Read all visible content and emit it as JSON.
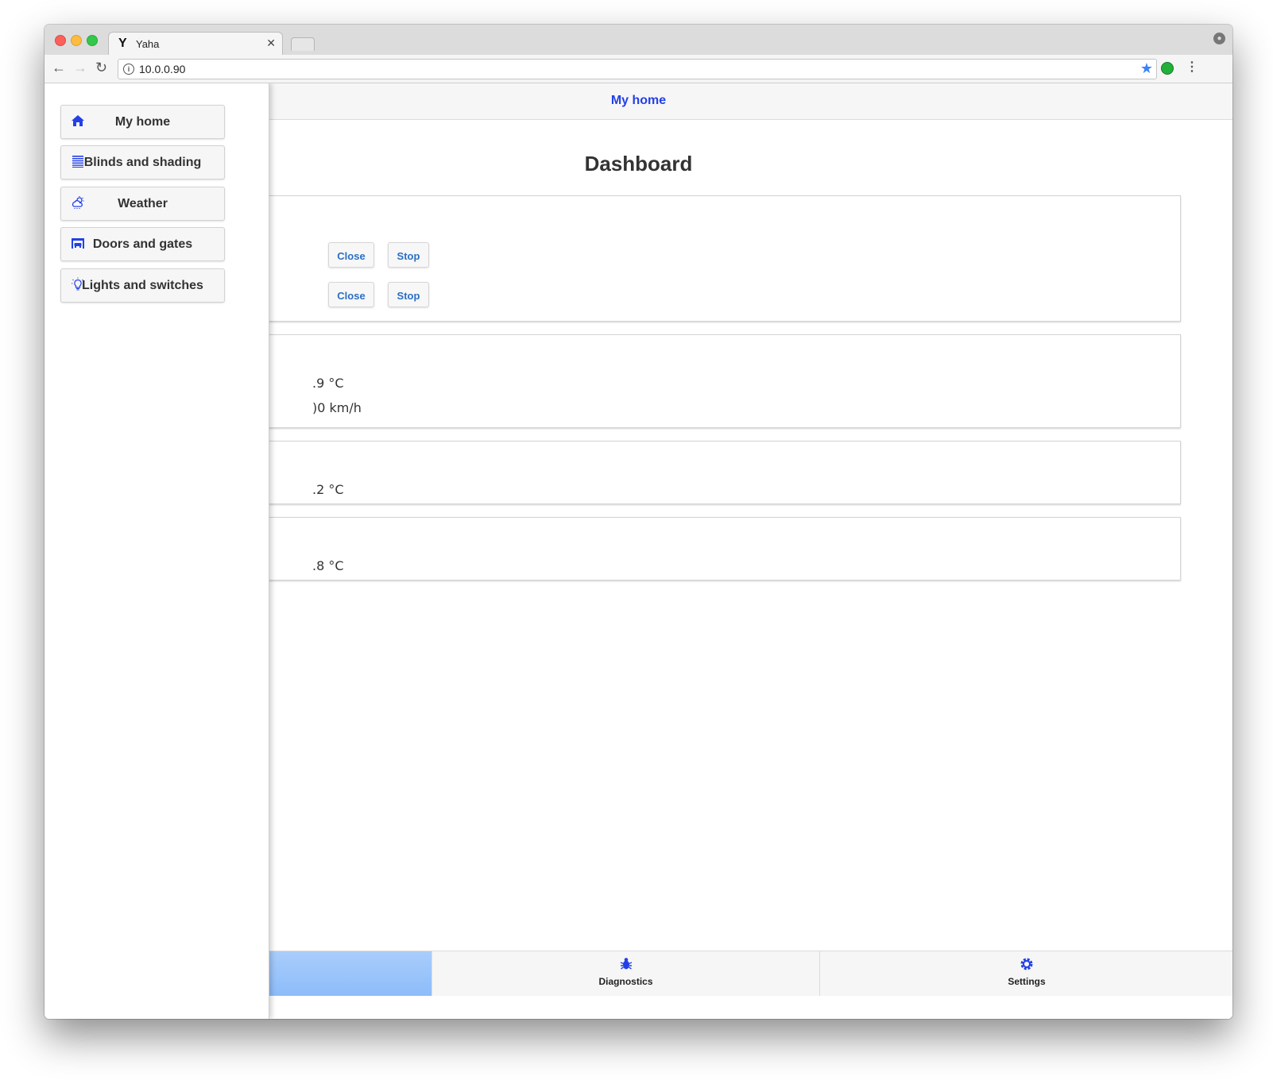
{
  "browser": {
    "tab_title": "Yaha",
    "tab_favicon": "Y",
    "url": "10.0.0.90"
  },
  "header": {
    "title": "My home"
  },
  "main": {
    "page_title": "Dashboard",
    "blinds": {
      "rows": [
        {
          "close_label": "Close",
          "stop_label": "Stop"
        },
        {
          "close_label": "Close",
          "stop_label": "Stop"
        }
      ]
    },
    "weather_card": {
      "temperature": ".9 °C",
      "wind": ")0 km/h"
    },
    "card3": {
      "temperature": ".2 °C"
    },
    "card4": {
      "temperature": ".8 °C"
    }
  },
  "sidebar": {
    "items": [
      {
        "label": "My home",
        "icon": "home-icon"
      },
      {
        "label": "Blinds and shading",
        "icon": "blinds-icon"
      },
      {
        "label": "Weather",
        "icon": "weather-icon"
      },
      {
        "label": "Doors and gates",
        "icon": "garage-icon"
      },
      {
        "label": "Lights and switches",
        "icon": "bulb-icon"
      }
    ]
  },
  "footer": {
    "items": [
      {
        "label": "Diagnostics",
        "icon": "bug-icon"
      },
      {
        "label": "Settings",
        "icon": "gear-icon"
      }
    ]
  },
  "colors": {
    "accent": "#2340e8",
    "button_text": "#2b6fc4",
    "active_tab": "#a9cdfb"
  }
}
